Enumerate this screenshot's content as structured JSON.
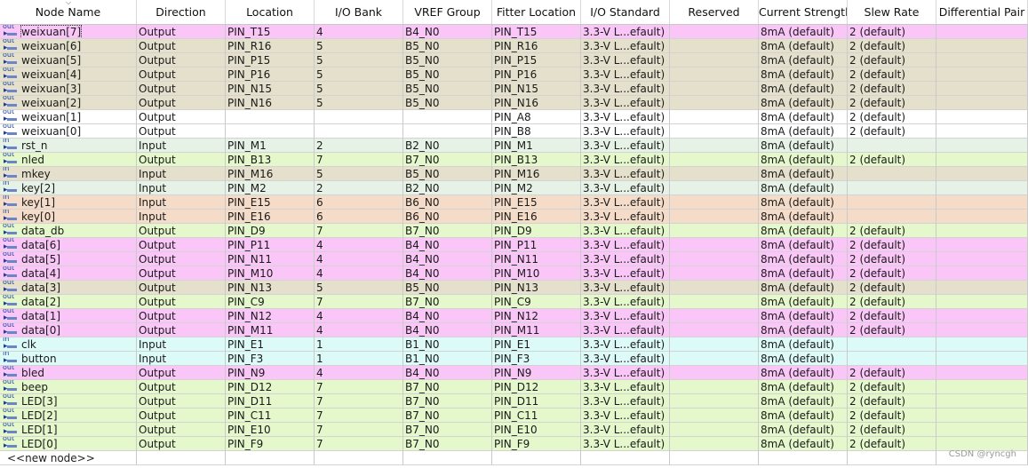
{
  "columns": [
    "Node Name",
    "Direction",
    "Location",
    "I/O Bank",
    "VREF Group",
    "Fitter Location",
    "I/O Standard",
    "Reserved",
    "Current Strength",
    "Slew Rate",
    "Differential Pair"
  ],
  "colors": {
    "pink": "#fac6f8",
    "tan": "#e4e0cc",
    "white": "#ffffff",
    "mint": "#e6f2e6",
    "green": "#e4f8cc",
    "peach": "#f5dcc8",
    "cyan": "#dcfaf8"
  },
  "rows": [
    {
      "name": "weixuan[7]",
      "dir": "Output",
      "loc": "PIN_T15",
      "bank": "4",
      "vref": "B4_N0",
      "fit": "PIN_T15",
      "std": "3.3-V L...efault)",
      "res": "",
      "cur": "8mA (default)",
      "slew": "2 (default)",
      "diff": "",
      "color": "pink"
    },
    {
      "name": "weixuan[6]",
      "dir": "Output",
      "loc": "PIN_R16",
      "bank": "5",
      "vref": "B5_N0",
      "fit": "PIN_R16",
      "std": "3.3-V L...efault)",
      "res": "",
      "cur": "8mA (default)",
      "slew": "2 (default)",
      "diff": "",
      "color": "tan"
    },
    {
      "name": "weixuan[5]",
      "dir": "Output",
      "loc": "PIN_P15",
      "bank": "5",
      "vref": "B5_N0",
      "fit": "PIN_P15",
      "std": "3.3-V L...efault)",
      "res": "",
      "cur": "8mA (default)",
      "slew": "2 (default)",
      "diff": "",
      "color": "tan"
    },
    {
      "name": "weixuan[4]",
      "dir": "Output",
      "loc": "PIN_P16",
      "bank": "5",
      "vref": "B5_N0",
      "fit": "PIN_P16",
      "std": "3.3-V L...efault)",
      "res": "",
      "cur": "8mA (default)",
      "slew": "2 (default)",
      "diff": "",
      "color": "tan"
    },
    {
      "name": "weixuan[3]",
      "dir": "Output",
      "loc": "PIN_N15",
      "bank": "5",
      "vref": "B5_N0",
      "fit": "PIN_N15",
      "std": "3.3-V L...efault)",
      "res": "",
      "cur": "8mA (default)",
      "slew": "2 (default)",
      "diff": "",
      "color": "tan"
    },
    {
      "name": "weixuan[2]",
      "dir": "Output",
      "loc": "PIN_N16",
      "bank": "5",
      "vref": "B5_N0",
      "fit": "PIN_N16",
      "std": "3.3-V L...efault)",
      "res": "",
      "cur": "8mA (default)",
      "slew": "2 (default)",
      "diff": "",
      "color": "tan"
    },
    {
      "name": "weixuan[1]",
      "dir": "Output",
      "loc": "",
      "bank": "",
      "vref": "",
      "fit": "PIN_A8",
      "std": "3.3-V L...efault)",
      "res": "",
      "cur": "8mA (default)",
      "slew": "2 (default)",
      "diff": "",
      "color": "white"
    },
    {
      "name": "weixuan[0]",
      "dir": "Output",
      "loc": "",
      "bank": "",
      "vref": "",
      "fit": "PIN_B8",
      "std": "3.3-V L...efault)",
      "res": "",
      "cur": "8mA (default)",
      "slew": "2 (default)",
      "diff": "",
      "color": "white"
    },
    {
      "name": "rst_n",
      "dir": "Input",
      "loc": "PIN_M1",
      "bank": "2",
      "vref": "B2_N0",
      "fit": "PIN_M1",
      "std": "3.3-V L...efault)",
      "res": "",
      "cur": "8mA (default)",
      "slew": "",
      "diff": "",
      "color": "mint"
    },
    {
      "name": "nled",
      "dir": "Output",
      "loc": "PIN_B13",
      "bank": "7",
      "vref": "B7_N0",
      "fit": "PIN_B13",
      "std": "3.3-V L...efault)",
      "res": "",
      "cur": "8mA (default)",
      "slew": "2 (default)",
      "diff": "",
      "color": "green"
    },
    {
      "name": "mkey",
      "dir": "Input",
      "loc": "PIN_M16",
      "bank": "5",
      "vref": "B5_N0",
      "fit": "PIN_M16",
      "std": "3.3-V L...efault)",
      "res": "",
      "cur": "8mA (default)",
      "slew": "",
      "diff": "",
      "color": "tan"
    },
    {
      "name": "key[2]",
      "dir": "Input",
      "loc": "PIN_M2",
      "bank": "2",
      "vref": "B2_N0",
      "fit": "PIN_M2",
      "std": "3.3-V L...efault)",
      "res": "",
      "cur": "8mA (default)",
      "slew": "",
      "diff": "",
      "color": "mint"
    },
    {
      "name": "key[1]",
      "dir": "Input",
      "loc": "PIN_E15",
      "bank": "6",
      "vref": "B6_N0",
      "fit": "PIN_E15",
      "std": "3.3-V L...efault)",
      "res": "",
      "cur": "8mA (default)",
      "slew": "",
      "diff": "",
      "color": "peach"
    },
    {
      "name": "key[0]",
      "dir": "Input",
      "loc": "PIN_E16",
      "bank": "6",
      "vref": "B6_N0",
      "fit": "PIN_E16",
      "std": "3.3-V L...efault)",
      "res": "",
      "cur": "8mA (default)",
      "slew": "",
      "diff": "",
      "color": "peach"
    },
    {
      "name": "data_db",
      "dir": "Output",
      "loc": "PIN_D9",
      "bank": "7",
      "vref": "B7_N0",
      "fit": "PIN_D9",
      "std": "3.3-V L...efault)",
      "res": "",
      "cur": "8mA (default)",
      "slew": "2 (default)",
      "diff": "",
      "color": "green"
    },
    {
      "name": "data[6]",
      "dir": "Output",
      "loc": "PIN_P11",
      "bank": "4",
      "vref": "B4_N0",
      "fit": "PIN_P11",
      "std": "3.3-V L...efault)",
      "res": "",
      "cur": "8mA (default)",
      "slew": "2 (default)",
      "diff": "",
      "color": "pink"
    },
    {
      "name": "data[5]",
      "dir": "Output",
      "loc": "PIN_N11",
      "bank": "4",
      "vref": "B4_N0",
      "fit": "PIN_N11",
      "std": "3.3-V L...efault)",
      "res": "",
      "cur": "8mA (default)",
      "slew": "2 (default)",
      "diff": "",
      "color": "pink"
    },
    {
      "name": "data[4]",
      "dir": "Output",
      "loc": "PIN_M10",
      "bank": "4",
      "vref": "B4_N0",
      "fit": "PIN_M10",
      "std": "3.3-V L...efault)",
      "res": "",
      "cur": "8mA (default)",
      "slew": "2 (default)",
      "diff": "",
      "color": "pink"
    },
    {
      "name": "data[3]",
      "dir": "Output",
      "loc": "PIN_N13",
      "bank": "5",
      "vref": "B5_N0",
      "fit": "PIN_N13",
      "std": "3.3-V L...efault)",
      "res": "",
      "cur": "8mA (default)",
      "slew": "2 (default)",
      "diff": "",
      "color": "tan"
    },
    {
      "name": "data[2]",
      "dir": "Output",
      "loc": "PIN_C9",
      "bank": "7",
      "vref": "B7_N0",
      "fit": "PIN_C9",
      "std": "3.3-V L...efault)",
      "res": "",
      "cur": "8mA (default)",
      "slew": "2 (default)",
      "diff": "",
      "color": "green"
    },
    {
      "name": "data[1]",
      "dir": "Output",
      "loc": "PIN_N12",
      "bank": "4",
      "vref": "B4_N0",
      "fit": "PIN_N12",
      "std": "3.3-V L...efault)",
      "res": "",
      "cur": "8mA (default)",
      "slew": "2 (default)",
      "diff": "",
      "color": "pink"
    },
    {
      "name": "data[0]",
      "dir": "Output",
      "loc": "PIN_M11",
      "bank": "4",
      "vref": "B4_N0",
      "fit": "PIN_M11",
      "std": "3.3-V L...efault)",
      "res": "",
      "cur": "8mA (default)",
      "slew": "2 (default)",
      "diff": "",
      "color": "pink"
    },
    {
      "name": "clk",
      "dir": "Input",
      "loc": "PIN_E1",
      "bank": "1",
      "vref": "B1_N0",
      "fit": "PIN_E1",
      "std": "3.3-V L...efault)",
      "res": "",
      "cur": "8mA (default)",
      "slew": "",
      "diff": "",
      "color": "cyan"
    },
    {
      "name": "button",
      "dir": "Input",
      "loc": "PIN_F3",
      "bank": "1",
      "vref": "B1_N0",
      "fit": "PIN_F3",
      "std": "3.3-V L...efault)",
      "res": "",
      "cur": "8mA (default)",
      "slew": "",
      "diff": "",
      "color": "cyan"
    },
    {
      "name": "bled",
      "dir": "Output",
      "loc": "PIN_N9",
      "bank": "4",
      "vref": "B4_N0",
      "fit": "PIN_N9",
      "std": "3.3-V L...efault)",
      "res": "",
      "cur": "8mA (default)",
      "slew": "2 (default)",
      "diff": "",
      "color": "pink"
    },
    {
      "name": "beep",
      "dir": "Output",
      "loc": "PIN_D12",
      "bank": "7",
      "vref": "B7_N0",
      "fit": "PIN_D12",
      "std": "3.3-V L...efault)",
      "res": "",
      "cur": "8mA (default)",
      "slew": "2 (default)",
      "diff": "",
      "color": "green"
    },
    {
      "name": "LED[3]",
      "dir": "Output",
      "loc": "PIN_D11",
      "bank": "7",
      "vref": "B7_N0",
      "fit": "PIN_D11",
      "std": "3.3-V L...efault)",
      "res": "",
      "cur": "8mA (default)",
      "slew": "2 (default)",
      "diff": "",
      "color": "green"
    },
    {
      "name": "LED[2]",
      "dir": "Output",
      "loc": "PIN_C11",
      "bank": "7",
      "vref": "B7_N0",
      "fit": "PIN_C11",
      "std": "3.3-V L...efault)",
      "res": "",
      "cur": "8mA (default)",
      "slew": "2 (default)",
      "diff": "",
      "color": "green"
    },
    {
      "name": "LED[1]",
      "dir": "Output",
      "loc": "PIN_E10",
      "bank": "7",
      "vref": "B7_N0",
      "fit": "PIN_E10",
      "std": "3.3-V L...efault)",
      "res": "",
      "cur": "8mA (default)",
      "slew": "2 (default)",
      "diff": "",
      "color": "green"
    },
    {
      "name": "LED[0]",
      "dir": "Output",
      "loc": "PIN_F9",
      "bank": "7",
      "vref": "B7_N0",
      "fit": "PIN_F9",
      "std": "3.3-V L...efault)",
      "res": "",
      "cur": "8mA (default)",
      "slew": "2 (default)",
      "diff": "",
      "color": "green"
    }
  ],
  "new_node_label": "<<new node>>",
  "watermark": "CSDN @ryncgh"
}
